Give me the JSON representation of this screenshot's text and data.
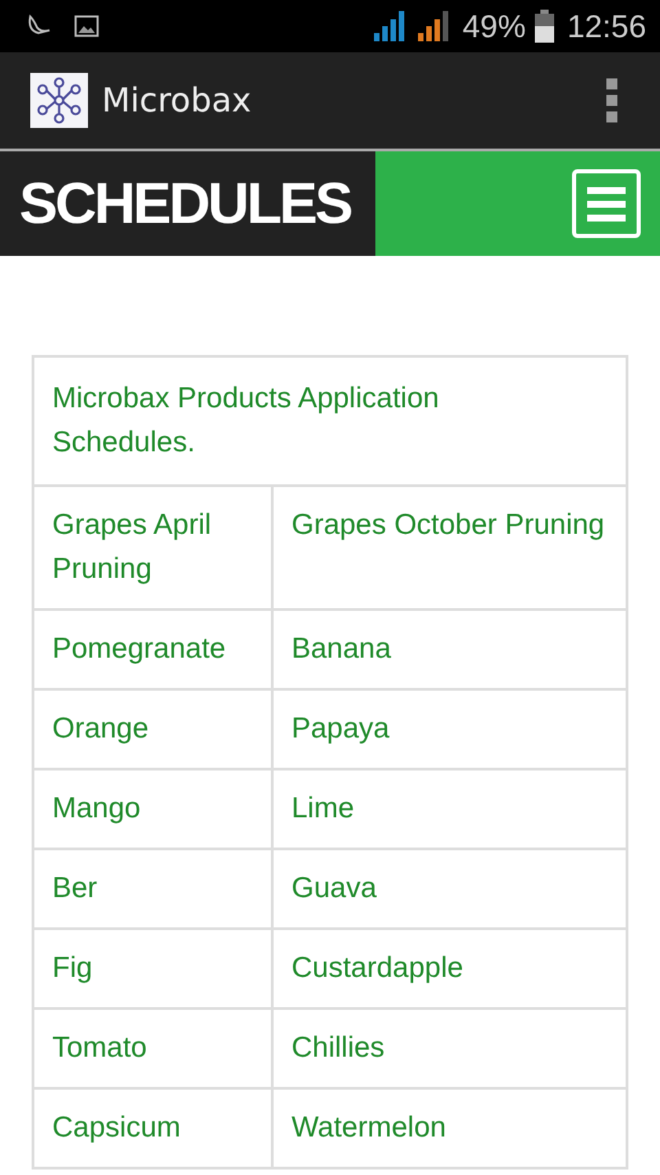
{
  "status_bar": {
    "battery": "49%",
    "time": "12:56"
  },
  "app_bar": {
    "title": "Microbax"
  },
  "header": {
    "title": "SCHEDULES"
  },
  "table": {
    "title": "Microbax Products Application Schedules.",
    "rows": [
      [
        "Grapes April Pruning",
        "Grapes October Pruning"
      ],
      [
        "Pomegranate",
        "Banana"
      ],
      [
        "Orange",
        "Papaya"
      ],
      [
        "Mango",
        "Lime"
      ],
      [
        "Ber",
        "Guava"
      ],
      [
        "Fig",
        "Custardapple"
      ],
      [
        "Tomato",
        "Chillies"
      ],
      [
        "Capsicum",
        "Watermelon"
      ]
    ]
  }
}
